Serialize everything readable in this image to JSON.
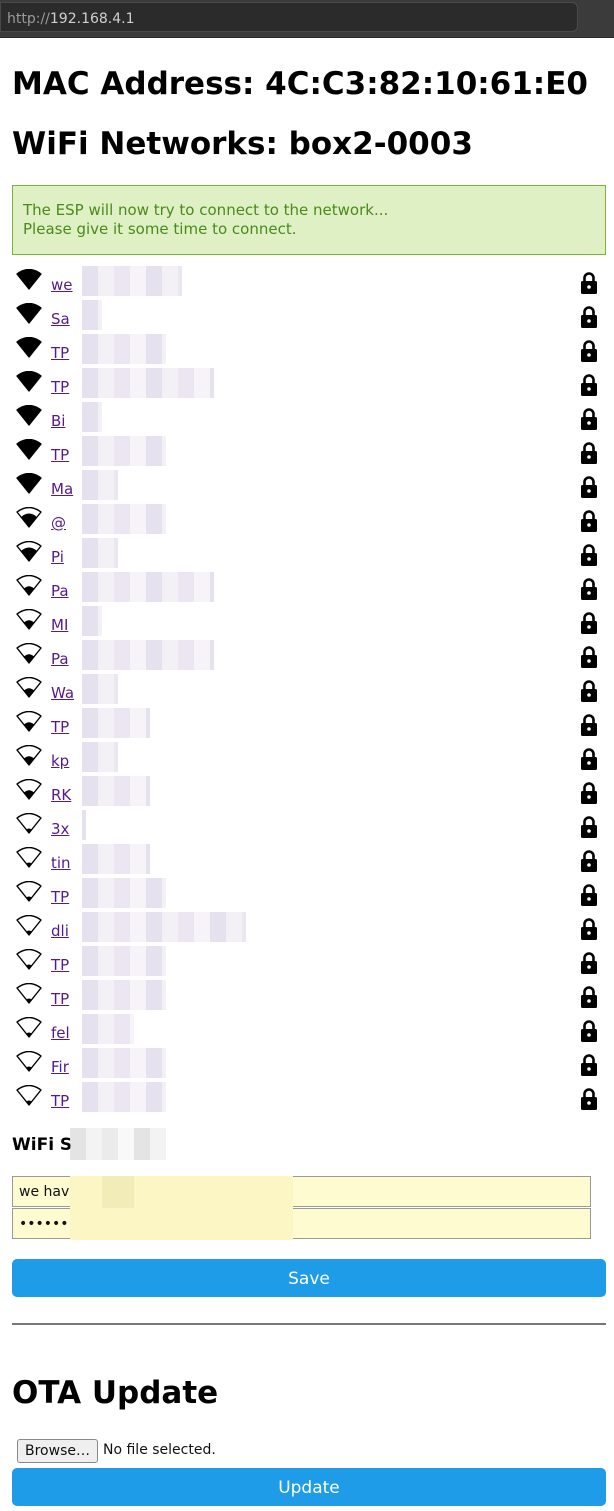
{
  "browser": {
    "url_scheme": "http://",
    "url_host": "192.168.4.1"
  },
  "header": {
    "mac_label": "MAC Address: 4C:C3:82:10:61:E0",
    "wifi_label": "WiFi Networks: box2-0003"
  },
  "notice": {
    "line1": "The ESP will now try to connect to the network...",
    "line2": "Please give it some time to connect."
  },
  "networks": [
    {
      "name": "we",
      "signal": 4
    },
    {
      "name": "Sa",
      "signal": 4
    },
    {
      "name": "TP",
      "signal": 4
    },
    {
      "name": "TP",
      "signal": 4
    },
    {
      "name": "Bi",
      "signal": 4
    },
    {
      "name": "TP",
      "signal": 4
    },
    {
      "name": "Ma",
      "signal": 4
    },
    {
      "name": "@",
      "signal": 3
    },
    {
      "name": "Pi",
      "signal": 3
    },
    {
      "name": "Pa",
      "signal": 2
    },
    {
      "name": "MI",
      "signal": 2
    },
    {
      "name": "Pa",
      "signal": 2
    },
    {
      "name": "Wa",
      "signal": 2
    },
    {
      "name": "TP",
      "signal": 2
    },
    {
      "name": "kp",
      "signal": 2
    },
    {
      "name": "RK",
      "signal": 2
    },
    {
      "name": "3x",
      "signal": 1
    },
    {
      "name": "tin",
      "signal": 1
    },
    {
      "name": "TP",
      "signal": 1
    },
    {
      "name": "dli",
      "signal": 1
    },
    {
      "name": "TP",
      "signal": 1
    },
    {
      "name": "TP",
      "signal": 1
    },
    {
      "name": "fel",
      "signal": 1
    },
    {
      "name": "Fir",
      "signal": 1
    },
    {
      "name": "TP",
      "signal": 1
    }
  ],
  "form": {
    "section_label": "WiFi S",
    "ssid_value": "we hav",
    "password_value": "••••••••",
    "save_label": "Save"
  },
  "ota": {
    "title": "OTA Update",
    "browse_label": "Browse…",
    "file_status": "No file selected.",
    "update_label": "Update"
  },
  "colors": {
    "button": "#1e9ce8",
    "notice_bg": "#dff0c4",
    "notice_text": "#4a8a1c",
    "link": "#551a8b",
    "input_bg": "#fefbd0"
  }
}
